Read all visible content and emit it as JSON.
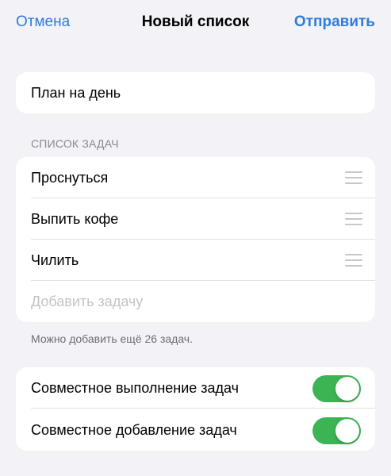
{
  "navbar": {
    "cancel_label": "Отмена",
    "title": "Новый список",
    "send_label": "Отправить"
  },
  "list_title": {
    "value": "План на день"
  },
  "tasks_section": {
    "header": "СПИСОК ЗАДАЧ",
    "items": [
      {
        "label": "Проснуться",
        "handle_icon": "drag-handle-icon"
      },
      {
        "label": "Выпить кофе",
        "handle_icon": "drag-handle-icon"
      },
      {
        "label": "Чилить",
        "handle_icon": "drag-handle-icon"
      }
    ],
    "add_placeholder": "Добавить задачу",
    "footer": "Можно добавить ещё 26 задач."
  },
  "settings": {
    "items": [
      {
        "label": "Совместное выполнение задач",
        "enabled": true
      },
      {
        "label": "Совместное добавление задач",
        "enabled": true
      }
    ]
  },
  "colors": {
    "accent": "#2F7CDB",
    "toggle_on": "#3DB453",
    "background": "#F2F2F7",
    "placeholder": "#C4C4C6",
    "secondary_text": "#8A8A8E"
  }
}
